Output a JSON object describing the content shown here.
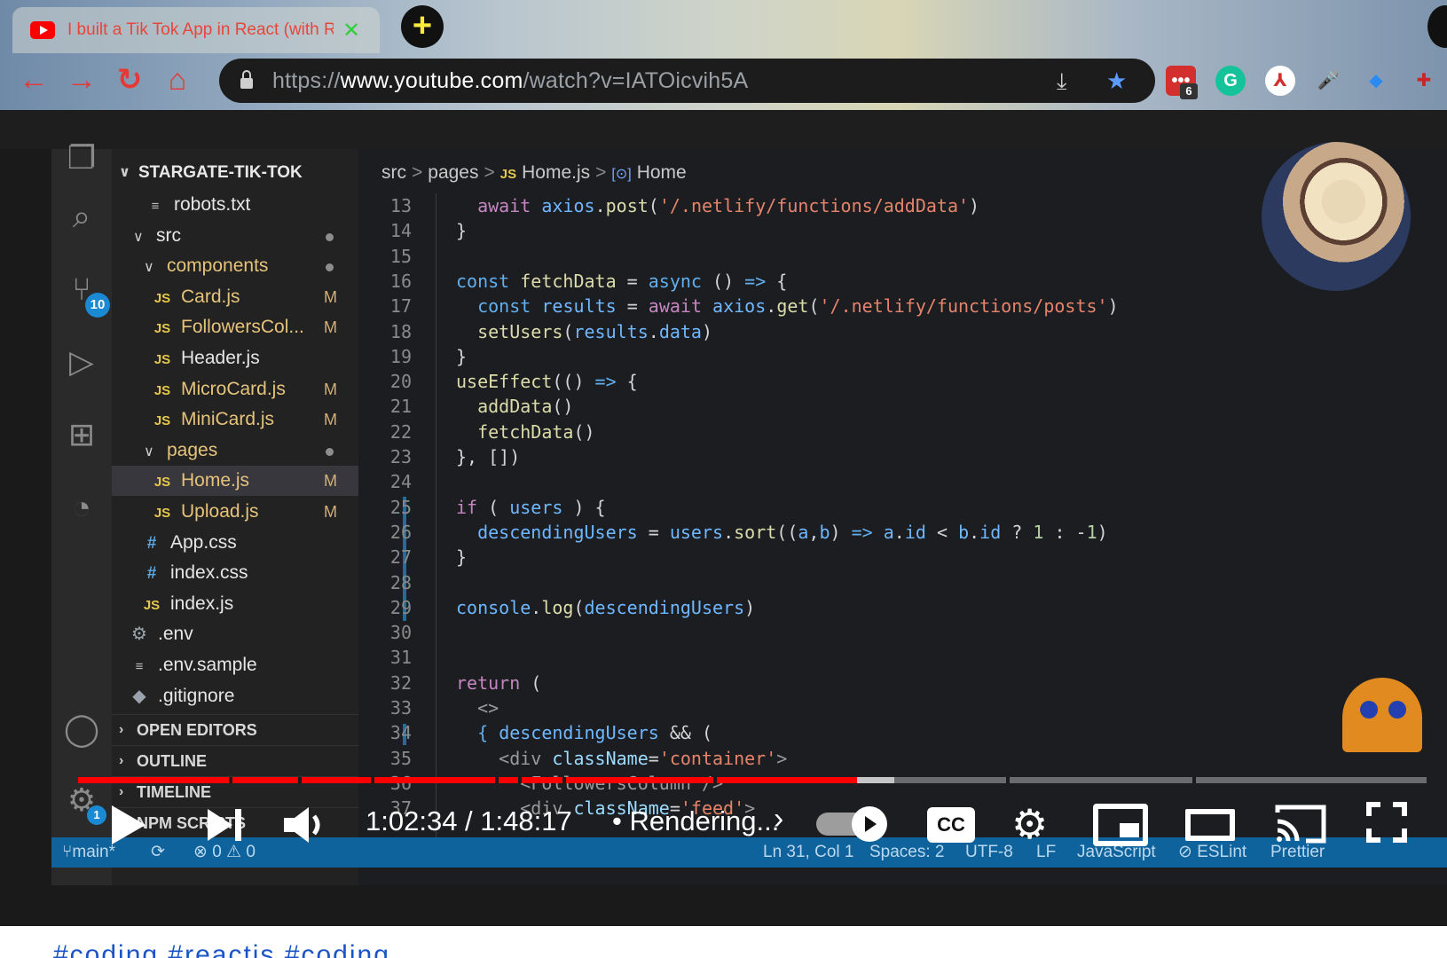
{
  "browser": {
    "tab_title": "I built a Tik Tok App in React (with R",
    "tab_close": "✕",
    "new_tab": "+",
    "url_scheme": "https://",
    "url_host": "www.youtube.com",
    "url_path": "/watch?v=IATOicvih5A",
    "extension_badge_count": "6",
    "accent_color": "#e53935"
  },
  "vscode": {
    "explorer_title": "STARGATE-TIK-TOK",
    "source_control_badge": "10",
    "settings_badge": "1",
    "tree": [
      {
        "label": "robots.txt",
        "icon": "≡",
        "kind": "txt",
        "indent": 36
      },
      {
        "label": "src",
        "chevron": "∨",
        "indent": 24,
        "dot": true
      },
      {
        "label": "components",
        "chevron": "∨",
        "indent": 36,
        "dot": true,
        "modified": true
      },
      {
        "label": "Card.js",
        "icon": "JS",
        "kind": "js",
        "indent": 44,
        "status": "M",
        "modified": true
      },
      {
        "label": "FollowersCol...",
        "icon": "JS",
        "kind": "js",
        "indent": 44,
        "status": "M",
        "modified": true
      },
      {
        "label": "Header.js",
        "icon": "JS",
        "kind": "js",
        "indent": 44
      },
      {
        "label": "MicroCard.js",
        "icon": "JS",
        "kind": "js",
        "indent": 44,
        "status": "M",
        "modified": true
      },
      {
        "label": "MiniCard.js",
        "icon": "JS",
        "kind": "js",
        "indent": 44,
        "status": "M",
        "modified": true
      },
      {
        "label": "pages",
        "chevron": "∨",
        "indent": 36,
        "dot": true,
        "modified": true
      },
      {
        "label": "Home.js",
        "icon": "JS",
        "kind": "js",
        "indent": 44,
        "status": "M",
        "modified": true,
        "active": true
      },
      {
        "label": "Upload.js",
        "icon": "JS",
        "kind": "js",
        "indent": 44,
        "status": "M",
        "modified": true
      },
      {
        "label": "App.css",
        "icon": "#",
        "kind": "css",
        "indent": 32
      },
      {
        "label": "index.css",
        "icon": "#",
        "kind": "css",
        "indent": 32
      },
      {
        "label": "index.js",
        "icon": "JS",
        "kind": "js",
        "indent": 32
      },
      {
        "label": ".env",
        "icon": "⚙",
        "kind": "gear",
        "indent": 18
      },
      {
        "label": ".env.sample",
        "icon": "≡",
        "kind": "txt",
        "indent": 18
      },
      {
        "label": ".gitignore",
        "icon": "◆",
        "kind": "gear",
        "indent": 18
      }
    ],
    "sections": [
      "OPEN EDITORS",
      "OUTLINE",
      "TIMELINE",
      "NPM SCRIPTS"
    ],
    "breadcrumb": {
      "part1": "src",
      "part2": "pages",
      "file": "Home.js",
      "symbol": "Home",
      "sep": ">",
      "js_icon": "JS",
      "sym_icon": "[⊙]"
    },
    "code_lines": [
      {
        "n": "13",
        "html": "  <span class='kwp'>await</span> <span class='var'>axios</span>.<span class='fn'>post</span>(<span class='str'>'/.netlify/functions/addData'</span>)"
      },
      {
        "n": "14",
        "html": "}"
      },
      {
        "n": "15",
        "html": ""
      },
      {
        "n": "16",
        "html": "<span class='kw2'>const</span> <span class='fn'>fetchData</span> = <span class='kw2'>async</span> () <span class='kw2'>=&gt;</span> {"
      },
      {
        "n": "17",
        "html": "  <span class='kw2'>const</span> <span class='var'>results</span> = <span class='kwp'>await</span> <span class='var'>axios</span>.<span class='fn'>get</span>(<span class='str'>'/.netlify/functions/posts'</span>)"
      },
      {
        "n": "18",
        "html": "  <span class='fn'>setUsers</span>(<span class='var'>results</span>.<span class='var'>data</span>)"
      },
      {
        "n": "19",
        "html": "}"
      },
      {
        "n": "20",
        "html": "<span class='fn'>useEffect</span>(() <span class='kw2'>=&gt;</span> {"
      },
      {
        "n": "21",
        "html": "  <span class='fn'>addData</span>()"
      },
      {
        "n": "22",
        "html": "  <span class='fn'>fetchData</span>()"
      },
      {
        "n": "23",
        "html": "}, [])"
      },
      {
        "n": "24",
        "html": ""
      },
      {
        "n": "25",
        "html": "<span class='kwp'>if</span> ( <span class='var'>users</span> ) {"
      },
      {
        "n": "26",
        "html": "  <span class='var'>descendingUsers</span> = <span class='var'>users</span>.<span class='fn'>sort</span>((<span class='var'>a</span>,<span class='var'>b</span>) <span class='kw2'>=&gt;</span> <span class='var'>a</span>.<span class='var'>id</span> &lt; <span class='var'>b</span>.<span class='var'>id</span> ? <span class='num'>1</span> : -<span class='num'>1</span>)"
      },
      {
        "n": "27",
        "html": "}"
      },
      {
        "n": "28",
        "html": ""
      },
      {
        "n": "29",
        "html": "<span class='var'>console</span>.<span class='fn'>log</span>(<span class='var'>descendingUsers</span>)"
      },
      {
        "n": "30",
        "html": ""
      },
      {
        "n": "31",
        "html": ""
      },
      {
        "n": "32",
        "html": "<span class='kwp'>return</span> ("
      },
      {
        "n": "33",
        "html": "  <span class='tag'>&lt;&gt;</span>"
      },
      {
        "n": "34",
        "html": "  <span class='kw2'>{</span> <span class='var'>descendingUsers</span> &amp;&amp; ("
      },
      {
        "n": "35",
        "html": "    <span class='tag'>&lt;div</span> <span class='attr'>className</span>=<span class='str'>'container'</span><span class='tag'>&gt;</span>"
      },
      {
        "n": "36",
        "html": "      <span class='tag'>&lt;FollowersColumn /&gt;</span>"
      },
      {
        "n": "37",
        "html": "      <span class='tag'>&lt;div</span> <span class='attr'>className</span>=<span class='str'>'feed'</span><span class='tag'>&gt;</span>"
      }
    ],
    "status": {
      "branch": "main*",
      "errors": "⊗ 0 ⚠ 0",
      "position": "Ln 31, Col 1",
      "spaces": "Spaces: 2",
      "encoding": "UTF-8",
      "eol": "LF",
      "language": "JavaScript",
      "eslint": "⊘ ESLint",
      "prettier": "Prettier"
    }
  },
  "player": {
    "current_time": "1:02:34",
    "duration": "1:48:17",
    "time_display": "1:02:34 / 1:48:17",
    "chapter": "• Rendering...",
    "chapter_chevron": "›",
    "cc_label": "CC",
    "played_fraction": 0.5778,
    "progress_color": "#ff0000"
  },
  "below": {
    "text": "#coding #reactjs    #coding"
  }
}
